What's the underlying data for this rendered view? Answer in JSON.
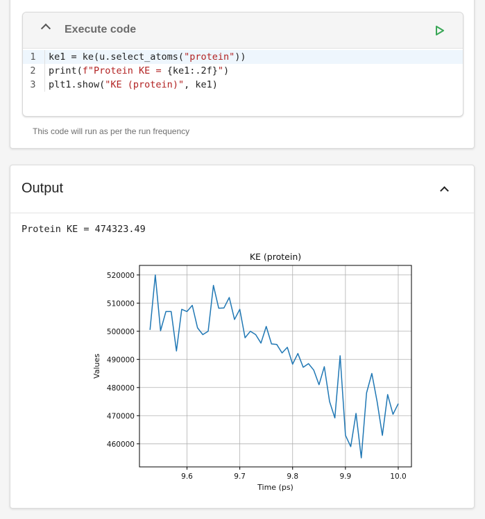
{
  "code_cell": {
    "title": "Execute code",
    "lines": [
      {
        "num": "1",
        "parts": [
          {
            "t": "ke1 = ke(u.select_atoms(",
            "c": "n"
          },
          {
            "t": "\"protein\"",
            "c": "s"
          },
          {
            "t": "))",
            "c": "n"
          }
        ]
      },
      {
        "num": "2",
        "parts": [
          {
            "t": "print(",
            "c": "n"
          },
          {
            "t": "f\"Protein KE = ",
            "c": "s"
          },
          {
            "t": "{ke1:.2f}",
            "c": "n"
          },
          {
            "t": "\"",
            "c": "s"
          },
          {
            "t": ")",
            "c": "n"
          }
        ]
      },
      {
        "num": "3",
        "parts": [
          {
            "t": "plt1.show(",
            "c": "n"
          },
          {
            "t": "\"KE (protein)\"",
            "c": "s"
          },
          {
            "t": ", ke1)",
            "c": "n"
          }
        ]
      }
    ],
    "run_note": "This code will run as per the run frequency",
    "icons": {
      "collapse": "chevron-up-icon",
      "run": "play-icon"
    },
    "run_color": "#3aa757"
  },
  "output": {
    "title": "Output",
    "text": "Protein KE = 474323.49"
  },
  "chart_data": {
    "type": "line",
    "title": "KE (protein)",
    "xlabel": "Time (ps)",
    "ylabel": "Values",
    "xlim": [
      9.51,
      10.025
    ],
    "ylim": [
      451800,
      523400
    ],
    "x_ticks": [
      "9.6",
      "9.7",
      "9.8",
      "9.9",
      "10.0"
    ],
    "x_tick_values": [
      9.6,
      9.7,
      9.8,
      9.9,
      10.0
    ],
    "y_ticks": [
      "460000",
      "470000",
      "480000",
      "490000",
      "500000",
      "510000",
      "520000"
    ],
    "y_tick_values": [
      460000,
      470000,
      480000,
      490000,
      500000,
      510000,
      520000
    ],
    "grid": true,
    "line_color": "#1f77b4",
    "series": [
      {
        "x": [
          9.53,
          9.54,
          9.55,
          9.56,
          9.57,
          9.58,
          9.59,
          9.6,
          9.61,
          9.62,
          9.63,
          9.64,
          9.65,
          9.66,
          9.67,
          9.68,
          9.69,
          9.7,
          9.71,
          9.72,
          9.73,
          9.74,
          9.75,
          9.76,
          9.77,
          9.78,
          9.79,
          9.8,
          9.81,
          9.82,
          9.83,
          9.84,
          9.85,
          9.86,
          9.87,
          9.88,
          9.89,
          9.9,
          9.91,
          9.92,
          9.93,
          9.94,
          9.95,
          9.96,
          9.97,
          9.98,
          9.99,
          10.0
        ],
        "y": [
          500500,
          520000,
          500200,
          507000,
          507000,
          493000,
          507800,
          507000,
          509200,
          501200,
          498800,
          500000,
          516300,
          508200,
          508300,
          512000,
          504200,
          507800,
          497700,
          500000,
          498800,
          495800,
          501700,
          495500,
          495300,
          492300,
          494300,
          488300,
          492100,
          487200,
          488500,
          486200,
          481000,
          487400,
          475000,
          469200,
          491300,
          463000,
          459000,
          470800,
          455000,
          478100,
          485000,
          475000,
          463000,
          477500,
          470500,
          474300
        ]
      }
    ]
  }
}
